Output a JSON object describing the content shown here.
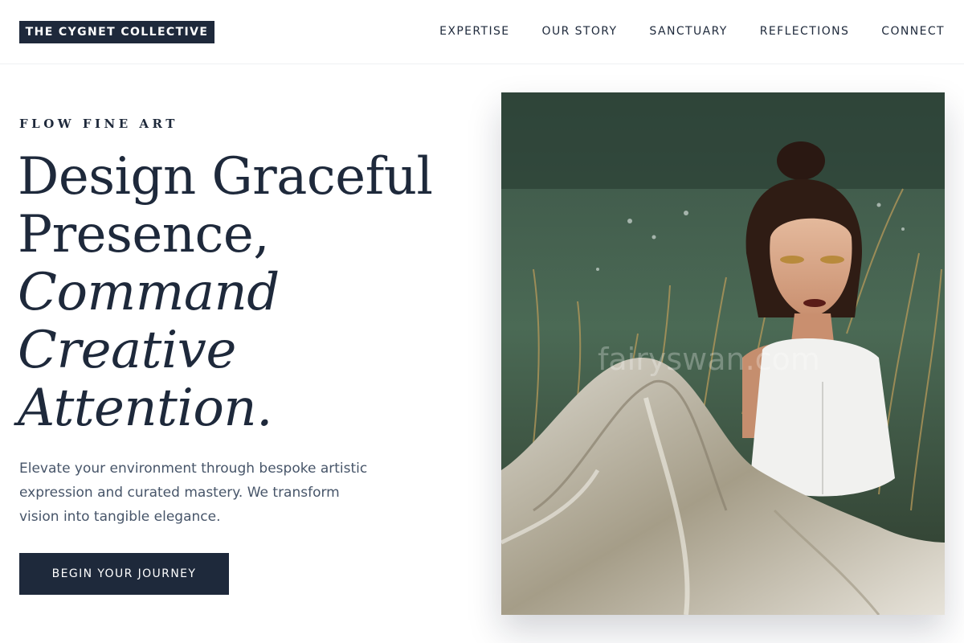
{
  "header": {
    "logo": "THE CYGNET COLLECTIVE",
    "nav": [
      "EXPERTISE",
      "OUR STORY",
      "SANCTUARY",
      "REFLECTIONS",
      "CONNECT"
    ]
  },
  "hero": {
    "eyebrow": "FLOW FINE ART",
    "headline_lines": [
      "Design Graceful",
      "Presence,",
      "Command",
      "Creative",
      "Attention."
    ],
    "body": "Elevate your environment through bespoke artistic expression and curated mastery. We transform vision into tangible elegance.",
    "cta": "BEGIN YOUR JOURNEY",
    "watermark": "fairyswan.com"
  },
  "colors": {
    "brand_navy": "#1e293b",
    "body_text": "#475569",
    "background": "#ffffff"
  }
}
